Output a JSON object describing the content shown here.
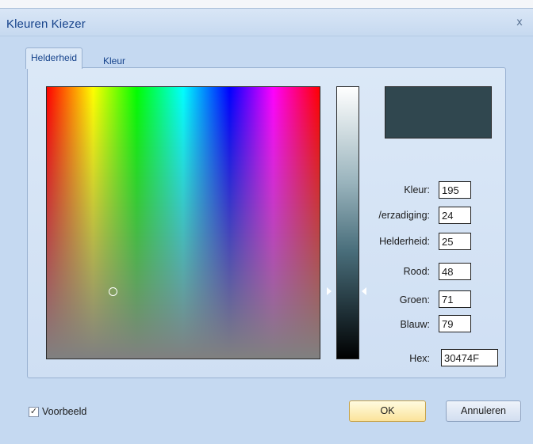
{
  "window": {
    "title": "Kleuren Kiezer",
    "close_glyph": "x"
  },
  "tabs": [
    {
      "label": "Helderheid",
      "active": true
    },
    {
      "label": "Kleur",
      "active": false
    }
  ],
  "color": {
    "preview_hex_color": "#30474F",
    "picker_saturation": 0.24,
    "picker_brightness": 0.25,
    "slider_brightness": 0.25
  },
  "fields": {
    "hue": {
      "label": "Kleur:",
      "value": "195"
    },
    "saturation": {
      "label": "/erzadiging:",
      "value": "24"
    },
    "brightness": {
      "label": "Helderheid:",
      "value": "25"
    },
    "red": {
      "label": "Rood:",
      "value": "48"
    },
    "green": {
      "label": "Groen:",
      "value": "71"
    },
    "blue": {
      "label": "Blauw:",
      "value": "79"
    },
    "hex": {
      "label": "Hex:",
      "value": "30474F"
    }
  },
  "footer": {
    "preview_label": "Voorbeeld",
    "preview_checked": true,
    "ok_label": "OK",
    "cancel_label": "Annuleren"
  },
  "colors": {
    "dialog_bg": "#c5d9f1",
    "title_text": "#15428b",
    "ok_button": "#fbe39a"
  }
}
